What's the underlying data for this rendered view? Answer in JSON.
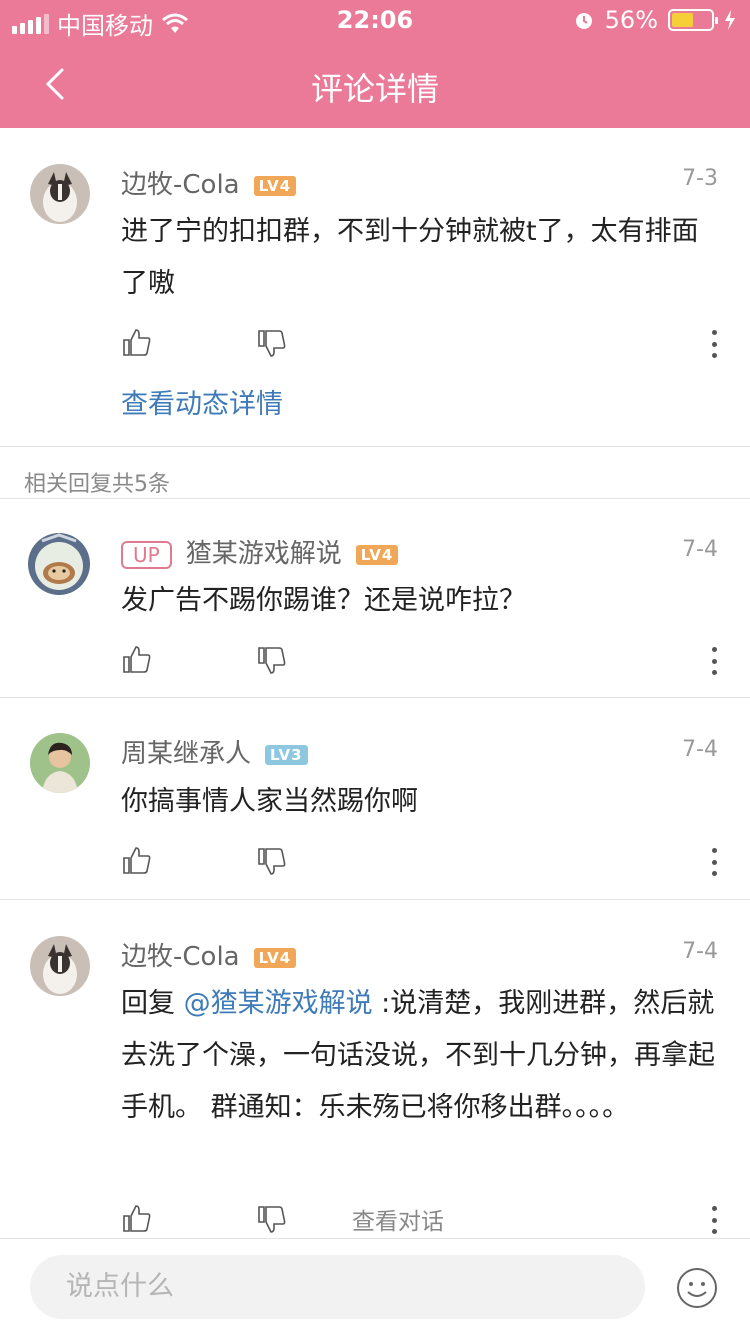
{
  "status": {
    "carrier": "中国移动",
    "time": "22:06",
    "battery": "56%",
    "battery_level": 0.56
  },
  "nav": {
    "title": "评论详情"
  },
  "main_comment": {
    "user": "边牧-Cola",
    "level": "LV4",
    "date": "7-3",
    "text": "进了宁的扣扣群，不到十分钟就被t了，太有排面了嗷",
    "view_link": "查看动态详情"
  },
  "replies_label": "相关回复共5条",
  "replies": [
    {
      "badge": "UP",
      "user": "猹某游戏解说",
      "level": "LV4",
      "date": "7-4",
      "text": "发广告不踢你踢谁？还是说咋拉？"
    },
    {
      "user": "周某继承人",
      "level": "LV3",
      "date": "7-4",
      "text": "你搞事情人家当然踢你啊"
    },
    {
      "user": "边牧-Cola",
      "level": "LV4",
      "date": "7-4",
      "text_prefix": "回复 ",
      "mention": "@猹某游戏解说",
      "text_suffix": " :说清楚，我刚进群，然后就去洗了个澡，一句话没说，不到十几分钟，再拿起手机。 群通知：乐未殇已将你移出群。。。。",
      "view_convo": "查看对话"
    }
  ],
  "bottom": {
    "placeholder": "说点什么"
  }
}
